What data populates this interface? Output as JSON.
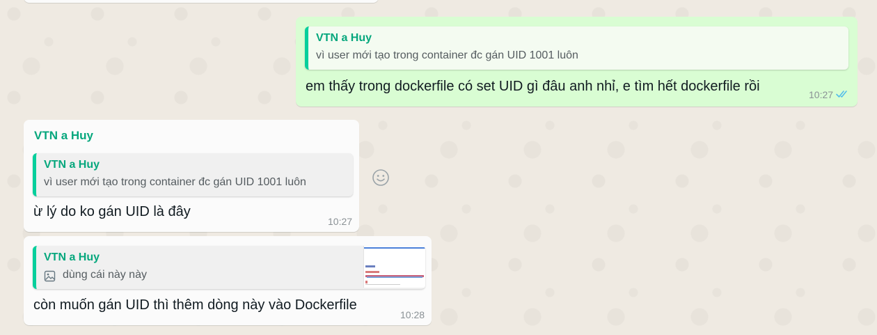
{
  "messages": [
    {
      "quote": {
        "author": "VTN a Huy",
        "text": "vì user mới tạo trong container đc gán UID 1001 luôn"
      },
      "text": "em thấy trong dockerfile có set UID gì đâu anh nhỉ, e tìm hết dockerfile rồi",
      "time": "10:27",
      "status_icon": "double-check-read-icon"
    },
    {
      "sender": "VTN a Huy",
      "quote": {
        "author": "VTN a Huy",
        "text": "vì user mới tạo trong container đc gán UID 1001 luôn"
      },
      "text": "ừ lý do ko gán UID là đây",
      "time": "10:27"
    },
    {
      "quote": {
        "author": "VTN a Huy",
        "text": "dùng cái này này",
        "icon": "image-icon"
      },
      "text": "còn muốn gán UID thì thêm dòng này vào Dockerfile",
      "time": "10:28"
    }
  ],
  "reaction_icon": "smiley-icon",
  "colors": {
    "incoming_bubble": "#fbfbfb",
    "outgoing_bubble": "#d9fdd3",
    "accent": "#06cf9c",
    "sender_name": "#06a77d",
    "read_ticks": "#53bdeb"
  }
}
